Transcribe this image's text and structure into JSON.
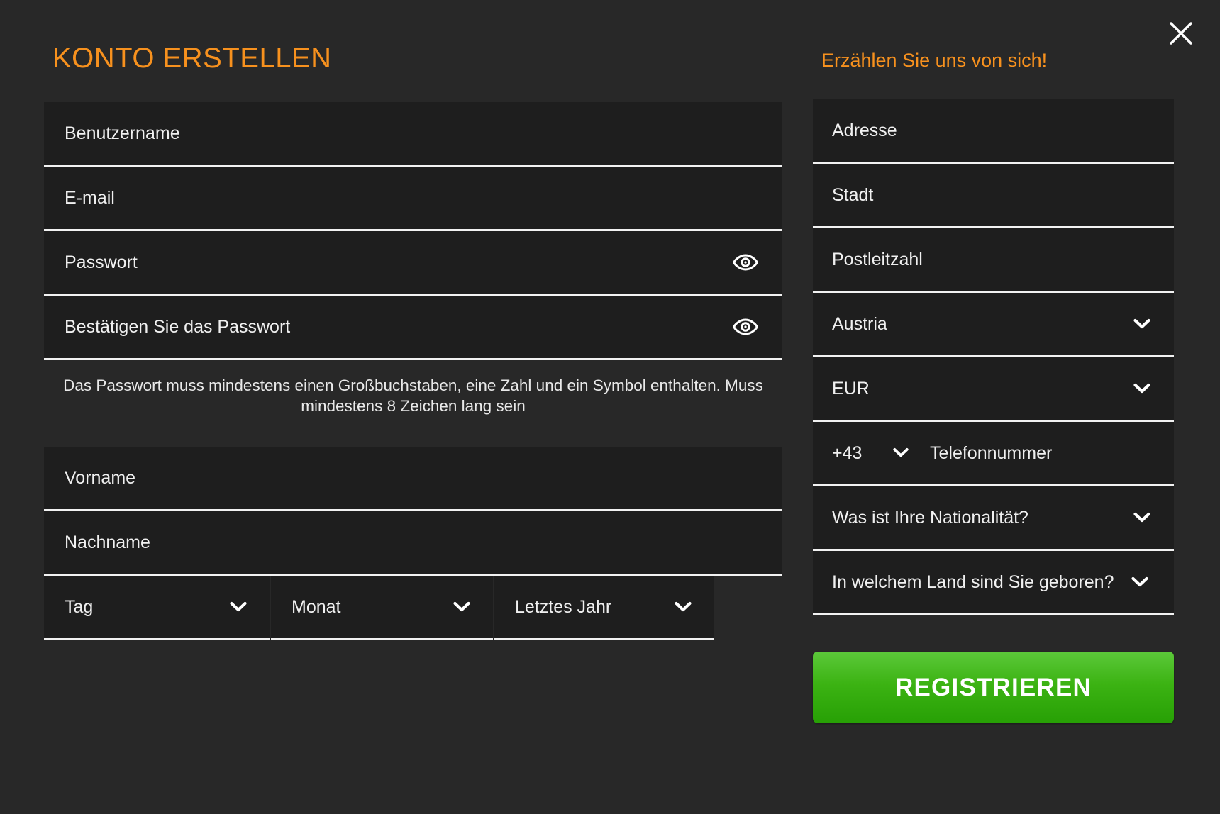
{
  "modal": {
    "close_icon": "close-icon",
    "left_title": "KONTO ERSTELLEN",
    "right_title": "Erzählen Sie uns von sich!"
  },
  "account": {
    "username_placeholder": "Benutzername",
    "email_placeholder": "E-mail",
    "password_placeholder": "Passwort",
    "confirm_password_placeholder": "Bestätigen Sie das Passwort",
    "password_toggle_icon": "eye-icon",
    "password_hint": "Das Passwort muss mindestens einen Großbuchstaben, eine Zahl und ein Symbol enthalten. Muss mindestens 8 Zeichen lang sein",
    "first_name_placeholder": "Vorname",
    "last_name_placeholder": "Nachname",
    "birthdate": {
      "day_label": "Tag",
      "month_label": "Monat",
      "year_label": "Letztes Jahr",
      "chevron_icon": "chevron-down-icon"
    }
  },
  "personal": {
    "address_placeholder": "Adresse",
    "city_placeholder": "Stadt",
    "postcode_placeholder": "Postleitzahl",
    "country_value": "Austria",
    "currency_value": "EUR",
    "phone_code_value": "+43",
    "phone_placeholder": "Telefonnummer",
    "nationality_value": "Was ist Ihre Nationalität?",
    "birth_country_value": "In welchem Land sind Sie geboren?",
    "chevron_icon": "chevron-down-icon",
    "submit_label": "REGISTRIEREN"
  },
  "colors": {
    "accent_orange": "#F7911E",
    "submit_green": "#3CB313",
    "page_bg": "#282828",
    "field_bg": "#1E1E1E",
    "field_border": "#F2F2F2"
  }
}
